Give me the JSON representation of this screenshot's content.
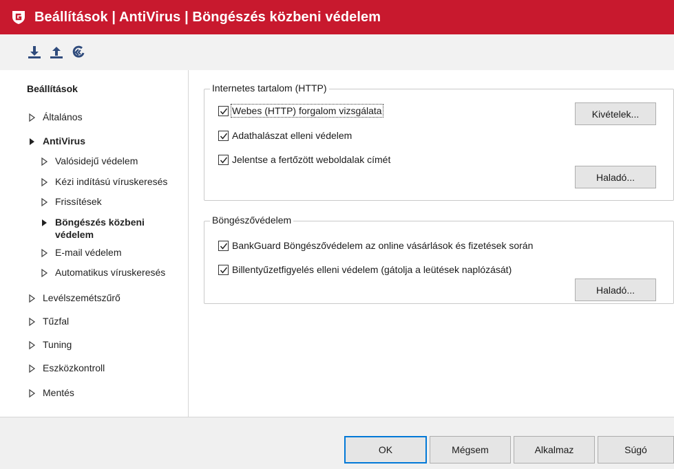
{
  "window": {
    "title": "Beállítások | AntiVirus | Böngészés közbeni védelem",
    "accent_color": "#c8192e"
  },
  "toolbar": {
    "buttons": [
      {
        "icon": "import-icon"
      },
      {
        "icon": "export-icon"
      },
      {
        "icon": "reset-icon"
      }
    ]
  },
  "sidebar": {
    "heading": "Beállítások",
    "items": [
      {
        "label": "Általános",
        "expanded": false
      },
      {
        "label": "AntiVirus",
        "expanded": true
      },
      {
        "label": "Valósidejű védelem"
      },
      {
        "label": "Kézi indítású víruskeresés"
      },
      {
        "label": "Frissítések"
      },
      {
        "label": "Böngészés közbeni védelem",
        "selected": true
      },
      {
        "label": "E-mail védelem"
      },
      {
        "label": "Automatikus víruskeresés"
      },
      {
        "label": "Levélszemétszűrő",
        "expanded": false
      },
      {
        "label": "Tűzfal",
        "expanded": false
      },
      {
        "label": "Tuning",
        "expanded": false
      },
      {
        "label": "Eszközkontroll",
        "expanded": false
      },
      {
        "label": "Mentés",
        "expanded": false
      }
    ]
  },
  "http_group": {
    "legend": "Internetes tartalom (HTTP)",
    "options": [
      {
        "label": "Webes (HTTP) forgalom vizsgálata",
        "checked": true
      },
      {
        "label": "Adathalászat elleni védelem",
        "checked": true
      },
      {
        "label": "Jelentse a fertőzött weboldalak címét",
        "checked": true
      }
    ],
    "exceptions_button": "Kivételek...",
    "advanced_button": "Haladó..."
  },
  "browser_group": {
    "legend": "Böngészővédelem",
    "options": [
      {
        "label": "BankGuard Böngészővédelem az online vásárlások és fizetések során",
        "checked": true
      },
      {
        "label": "Billentyűzetfigyelés elleni védelem (gátolja a leütések naplózását)",
        "checked": true
      }
    ],
    "advanced_button": "Haladó..."
  },
  "footer": {
    "ok": "OK",
    "cancel": "Mégsem",
    "apply": "Alkalmaz",
    "help": "Súgó"
  }
}
